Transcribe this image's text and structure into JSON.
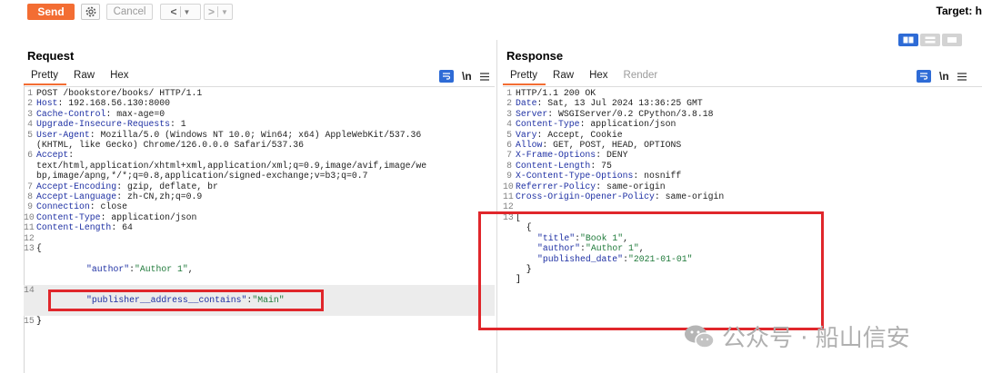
{
  "toolbar": {
    "send_label": "Send",
    "cancel_label": "Cancel",
    "back_label": "<",
    "forward_label": ">",
    "target_label": "Target: h"
  },
  "request": {
    "title": "Request",
    "tabs": [
      "Pretty",
      "Raw",
      "Hex"
    ],
    "active_tab": "Pretty",
    "newline_label": "\\n",
    "lines": [
      {
        "n": "1",
        "key": "POST /bookstore/books/ HTTP/1.1",
        "val": ""
      },
      {
        "n": "2",
        "key": "Host",
        "val": ": 192.168.56.130:8000"
      },
      {
        "n": "3",
        "key": "Cache-Control",
        "val": ": max-age=0"
      },
      {
        "n": "4",
        "key": "Upgrade-Insecure-Requests",
        "val": ": 1"
      },
      {
        "n": "5",
        "key": "User-Agent",
        "val": ": Mozilla/5.0 (Windows NT 10.0; Win64; x64) AppleWebKit/537.36"
      },
      {
        "n": "",
        "key": "",
        "val": "(KHTML, like Gecko) Chrome/126.0.0.0 Safari/537.36"
      },
      {
        "n": "6",
        "key": "Accept",
        "val": ":"
      },
      {
        "n": "",
        "key": "",
        "val": "text/html,application/xhtml+xml,application/xml;q=0.9,image/avif,image/we"
      },
      {
        "n": "",
        "key": "",
        "val": "bp,image/apng,*/*;q=0.8,application/signed-exchange;v=b3;q=0.7"
      },
      {
        "n": "7",
        "key": "Accept-Encoding",
        "val": ": gzip, deflate, br"
      },
      {
        "n": "8",
        "key": "Accept-Language",
        "val": ": zh-CN,zh;q=0.9"
      },
      {
        "n": "9",
        "key": "Connection",
        "val": ": close"
      },
      {
        "n": "10",
        "key": "Content-Type",
        "val": ": application/json"
      },
      {
        "n": "11",
        "key": "Content-Length",
        "val": ": 64"
      },
      {
        "n": "12",
        "key": "",
        "val": ""
      },
      {
        "n": "13",
        "key": "",
        "val": "{"
      }
    ],
    "json_author_key": "\"author\"",
    "json_author_val": "\"Author 1\"",
    "json_author_sep": ":",
    "json_author_comma": ",",
    "line14_n": "14",
    "json_pub_key": "\"publisher__address__contains\"",
    "json_pub_sep": ":",
    "json_pub_val": "\"Main\"",
    "line15_n": "15",
    "line15_txt": "}"
  },
  "response": {
    "title": "Response",
    "tabs": [
      "Pretty",
      "Raw",
      "Hex",
      "Render"
    ],
    "active_tab": "Pretty",
    "newline_label": "\\n",
    "lines": [
      {
        "n": "1",
        "key": "HTTP/1.1 200 OK",
        "val": ""
      },
      {
        "n": "2",
        "key": "Date",
        "val": ": Sat, 13 Jul 2024 13:36:25 GMT"
      },
      {
        "n": "3",
        "key": "Server",
        "val": ": WSGIServer/0.2 CPython/3.8.18"
      },
      {
        "n": "4",
        "key": "Content-Type",
        "val": ": application/json"
      },
      {
        "n": "5",
        "key": "Vary",
        "val": ": Accept, Cookie"
      },
      {
        "n": "6",
        "key": "Allow",
        "val": ": GET, POST, HEAD, OPTIONS"
      },
      {
        "n": "7",
        "key": "X-Frame-Options",
        "val": ": DENY"
      },
      {
        "n": "8",
        "key": "Content-Length",
        "val": ": 75"
      },
      {
        "n": "9",
        "key": "X-Content-Type-Options",
        "val": ": nosniff"
      },
      {
        "n": "10",
        "key": "Referrer-Policy",
        "val": ": same-origin"
      },
      {
        "n": "11",
        "key": "Cross-Origin-Opener-Policy",
        "val": ": same-origin"
      },
      {
        "n": "12",
        "key": "",
        "val": ""
      },
      {
        "n": "13",
        "key": "",
        "val": "["
      },
      {
        "n": "",
        "key": "",
        "val": "  {"
      }
    ],
    "json": [
      {
        "k": "\"title\"",
        "v": "\"Book 1\"",
        "end": ","
      },
      {
        "k": "\"author\"",
        "v": "\"Author 1\"",
        "end": ","
      },
      {
        "k": "\"published_date\"",
        "v": "\"2021-01-01\"",
        "end": ""
      }
    ],
    "obj_close": "  }",
    "arr_close": "]"
  },
  "watermark": {
    "text": "公众号 · 船山信安",
    "icon": "wechat-icon"
  },
  "colors": {
    "send": "#f36d33",
    "highlight_box": "#e0262b",
    "active_blue": "#2e6bd6"
  }
}
